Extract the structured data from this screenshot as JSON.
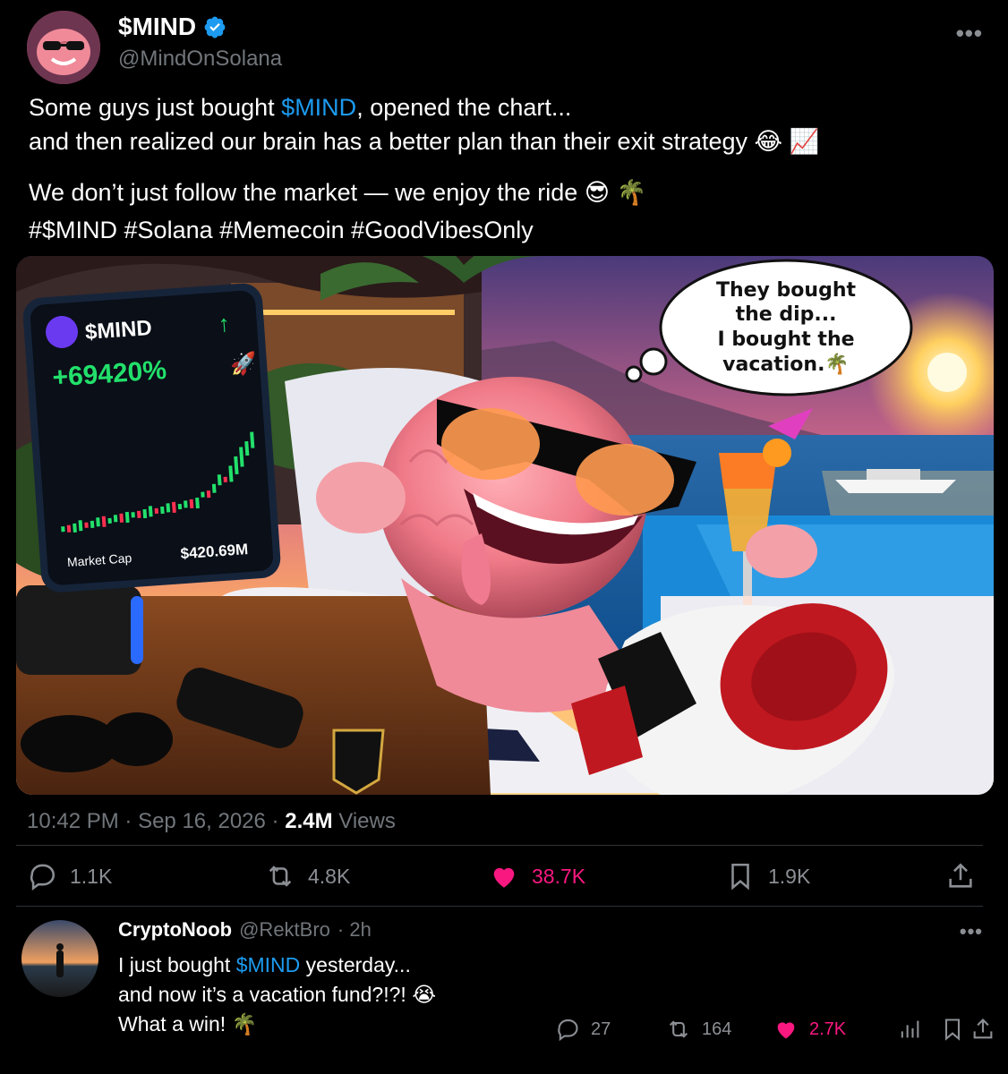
{
  "author": {
    "display_name": "$MIND",
    "handle": "@MindOnSolana"
  },
  "tweet": {
    "line1_prefix": "Some guys just bought ",
    "line1_cashtag": "$MIND",
    "line1_suffix": ", opened the chart...",
    "line2": "and then realized our brain has a better plan than their exit strategy",
    "line2_emoji": "😂 📈",
    "line3": "We don’t just follow the market — we enjoy the ride",
    "line3_emoji": "😎 🌴",
    "hashtags": "#$MIND #Solana #Memecoin #GoodVibesOnly"
  },
  "media": {
    "phone_ticker": "$MIND",
    "phone_change": "+69420%",
    "phone_marketcap_label": "Market Cap",
    "phone_marketcap_value": "$420.69M",
    "bubble_line1": "They bought",
    "bubble_line2": "the dip...",
    "bubble_line3": "I bought the",
    "bubble_line4": "vacation.🌴"
  },
  "meta": {
    "time": "10:42 PM",
    "dot": "·",
    "date": "Sep 16, 2026",
    "views_count": "2.4M",
    "views_label": "Views"
  },
  "actions": {
    "replies": "1.1K",
    "reposts": "4.8K",
    "likes": "38.7K",
    "bookmarks": "1.9K"
  },
  "reply": {
    "name": "CryptoNoob",
    "handle": "@RektBro",
    "time": "· 2h",
    "line1_prefix": "I just bought ",
    "line1_cashtag": "$MIND",
    "line1_suffix": " yesterday...",
    "line2": "and now it’s a vacation fund?!?!",
    "line2_emoji": "😭",
    "line3": "What a win!",
    "line3_emoji": "🌴",
    "replies": "27",
    "reposts": "164",
    "likes": "2.7K"
  },
  "colors": {
    "accent": "#1d9bf0",
    "like": "#f91880",
    "bullish": "#22e06b"
  }
}
